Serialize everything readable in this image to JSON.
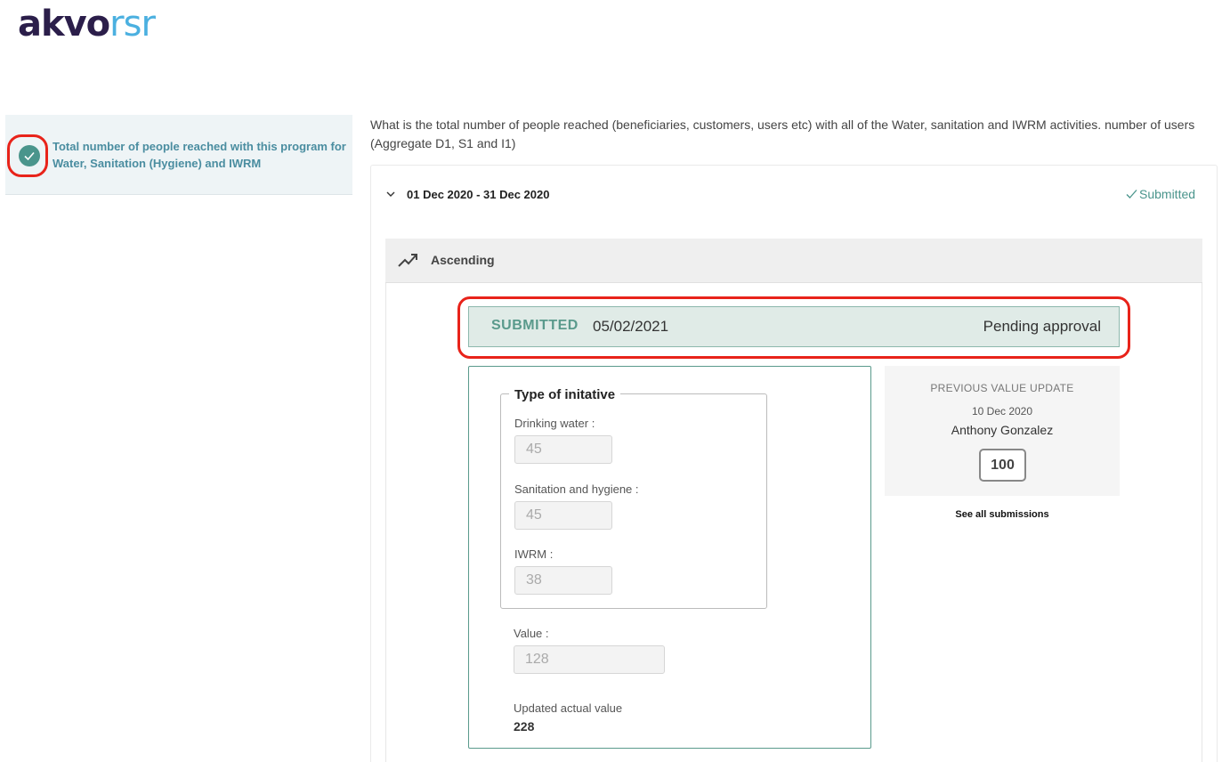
{
  "logo": {
    "part1": "akvo",
    "part2": "rsr"
  },
  "sidebar": {
    "items": [
      {
        "label": "Total number of people reached with this program for Water, Sanitation (Hygiene) and IWRM"
      }
    ]
  },
  "indicator": {
    "question": "What is the total number of people reached (beneficiaries, customers, users etc) with all of the Water, sanitation and IWRM activities. number of users (Aggregate D1, S1 and I1)"
  },
  "period": {
    "range": "01 Dec 2020 - 31 Dec 2020",
    "status": "Submitted",
    "measure": "Ascending"
  },
  "update": {
    "status_word": "SUBMITTED",
    "date": "05/02/2021",
    "approval": "Pending approval",
    "group_title": "Type of initative",
    "fields": [
      {
        "label": "Drinking water",
        "value": "45"
      },
      {
        "label": "Sanitation and hygiene",
        "value": "45"
      },
      {
        "label": "IWRM",
        "value": "38"
      }
    ],
    "value_label": "Value",
    "value": "128",
    "updated_label": "Updated actual value",
    "updated_value": "228"
  },
  "previous": {
    "title": "PREVIOUS VALUE UPDATE",
    "date": "10 Dec 2020",
    "user": "Anthony Gonzalez",
    "value": "100",
    "see_all": "See all submissions"
  },
  "colors": {
    "accent": "#4a958c",
    "annotation": "#e8231a",
    "brand_dark": "#2b1e4a",
    "brand_light": "#4bb0e0"
  }
}
